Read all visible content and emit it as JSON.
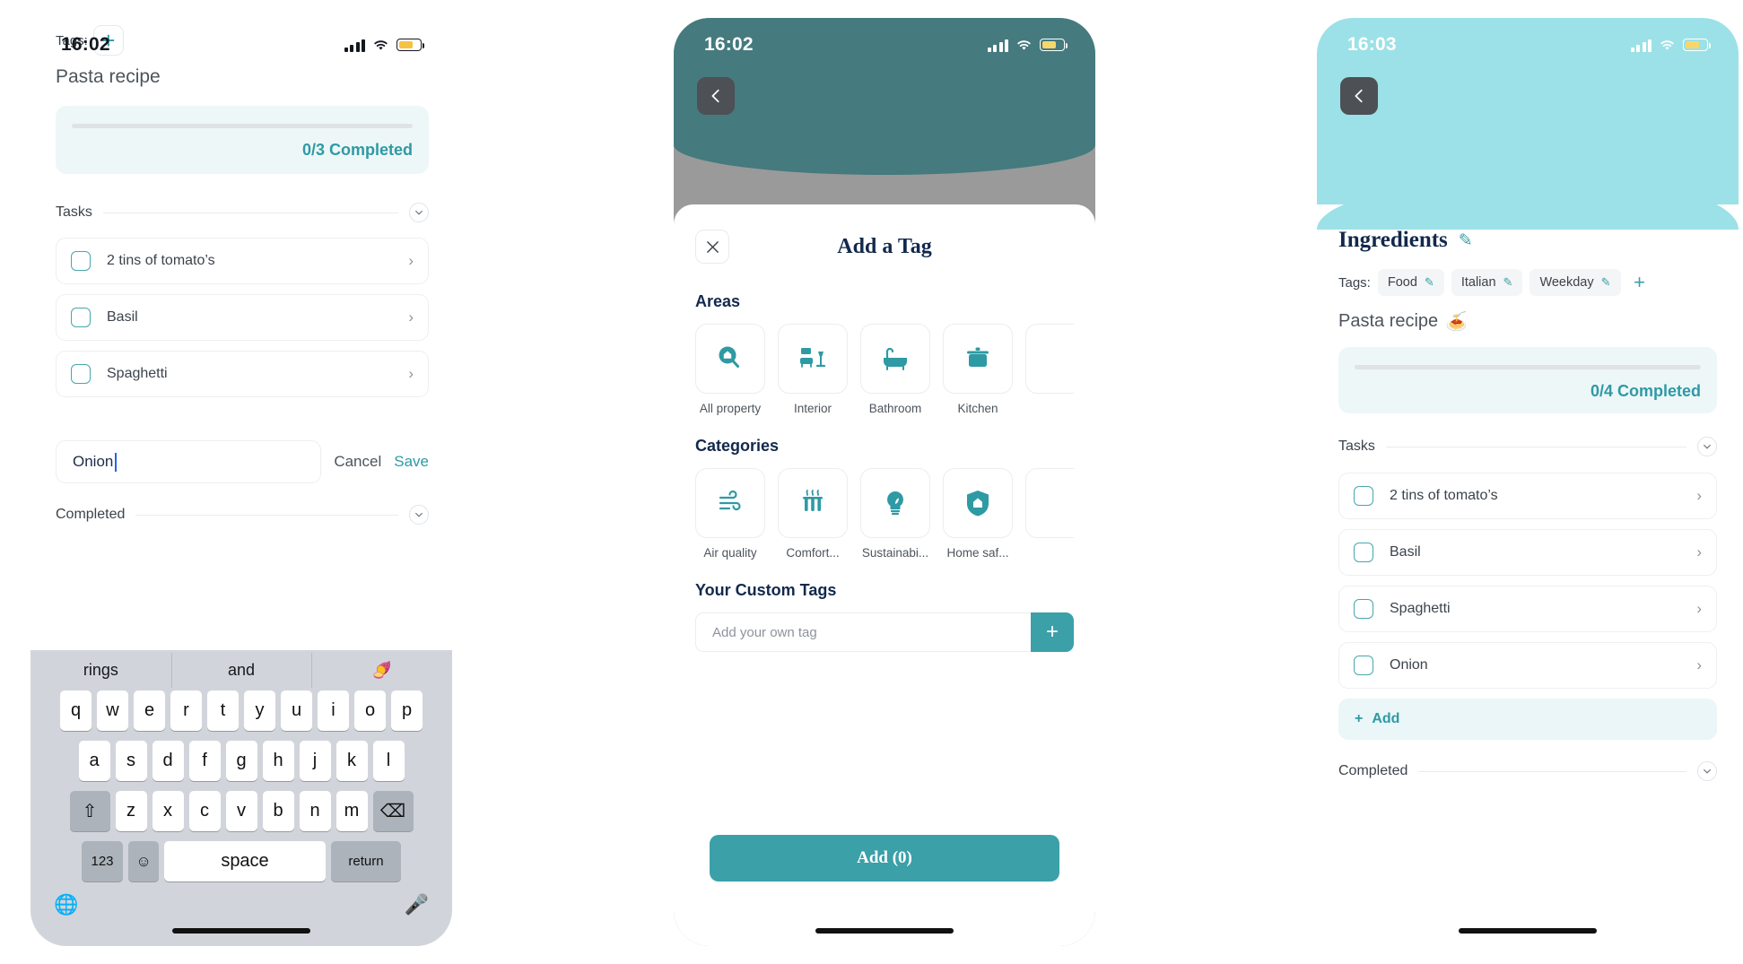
{
  "phone1": {
    "status": {
      "time": "16:02",
      "signal": "signal-bars",
      "wifi": "wifi-icon",
      "battery": "battery-icon"
    },
    "tags_label": "Tags:",
    "add_tag_plus": "+",
    "title": "Pasta recipe",
    "progress_text": "0/3 Completed",
    "progress_percent": 0,
    "sections": {
      "tasks": "Tasks",
      "completed": "Completed"
    },
    "tasks": [
      {
        "label": "2 tins of tomato’s",
        "checked": false
      },
      {
        "label": "Basil",
        "checked": false
      },
      {
        "label": "Spaghetti",
        "checked": false
      }
    ],
    "input_value": "Onion",
    "cancel_label": "Cancel",
    "save_label": "Save",
    "keyboard": {
      "suggestions": [
        "rings",
        "and",
        "🍠"
      ],
      "row1": [
        "q",
        "w",
        "e",
        "r",
        "t",
        "y",
        "u",
        "i",
        "o",
        "p"
      ],
      "row2": [
        "a",
        "s",
        "d",
        "f",
        "g",
        "h",
        "j",
        "k",
        "l"
      ],
      "row3": [
        "z",
        "x",
        "c",
        "v",
        "b",
        "n",
        "m"
      ],
      "shift": "⇧",
      "backspace": "⌫",
      "numbers": "123",
      "emoji": "☺",
      "space": "space",
      "return": "return",
      "globe": "🌐",
      "mic": "🎤"
    }
  },
  "phone2": {
    "status": {
      "time": "16:02"
    },
    "back_label": "back-arrow",
    "sheet_title": "Add a Tag",
    "close_label": "close",
    "areas_heading": "Areas",
    "areas": [
      {
        "label": "All property",
        "icon": "house-search-icon"
      },
      {
        "label": "Interior",
        "icon": "sofa-lamp-icon"
      },
      {
        "label": "Bathroom",
        "icon": "bathtub-icon"
      },
      {
        "label": "Kitchen",
        "icon": "pot-icon"
      },
      {
        "label": "",
        "icon": "partial-icon"
      }
    ],
    "categories_heading": "Categories",
    "categories": [
      {
        "label": "Air quality",
        "icon": "air-flow-icon"
      },
      {
        "label": "Comfort...",
        "icon": "radiator-icon"
      },
      {
        "label": "Sustainabi...",
        "icon": "leaf-bulb-icon"
      },
      {
        "label": "Home saf...",
        "icon": "home-shield-icon"
      },
      {
        "label": "",
        "icon": "partial-icon"
      }
    ],
    "custom_heading": "Your Custom Tags",
    "custom_placeholder": "Add your own tag",
    "custom_add": "+",
    "primary_button": "Add (0)"
  },
  "phone3": {
    "status": {
      "time": "16:03"
    },
    "back_label": "back-arrow",
    "title": "Ingredients",
    "edit_icon": "pencil-icon",
    "tags_label": "Tags:",
    "tags": [
      "Food",
      "Italian",
      "Weekday"
    ],
    "add_tag_plus": "+",
    "subtitle": "Pasta recipe",
    "subtitle_emoji": "🍝",
    "progress_text": "0/4 Completed",
    "progress_percent": 0,
    "sections": {
      "tasks": "Tasks",
      "completed": "Completed"
    },
    "tasks": [
      {
        "label": "2 tins of tomato’s",
        "checked": false
      },
      {
        "label": "Basil",
        "checked": false
      },
      {
        "label": "Spaghetti",
        "checked": false
      },
      {
        "label": "Onion",
        "checked": false
      }
    ],
    "add_label": "Add",
    "add_plus": "+"
  },
  "colors": {
    "teal": "#3ba0a8",
    "teal_dark": "#2e9aa4",
    "navy": "#12294c",
    "cyan_header": "#9ce1e7",
    "teal_header": "#457a7e",
    "progress_bg": "#eef7f8"
  }
}
